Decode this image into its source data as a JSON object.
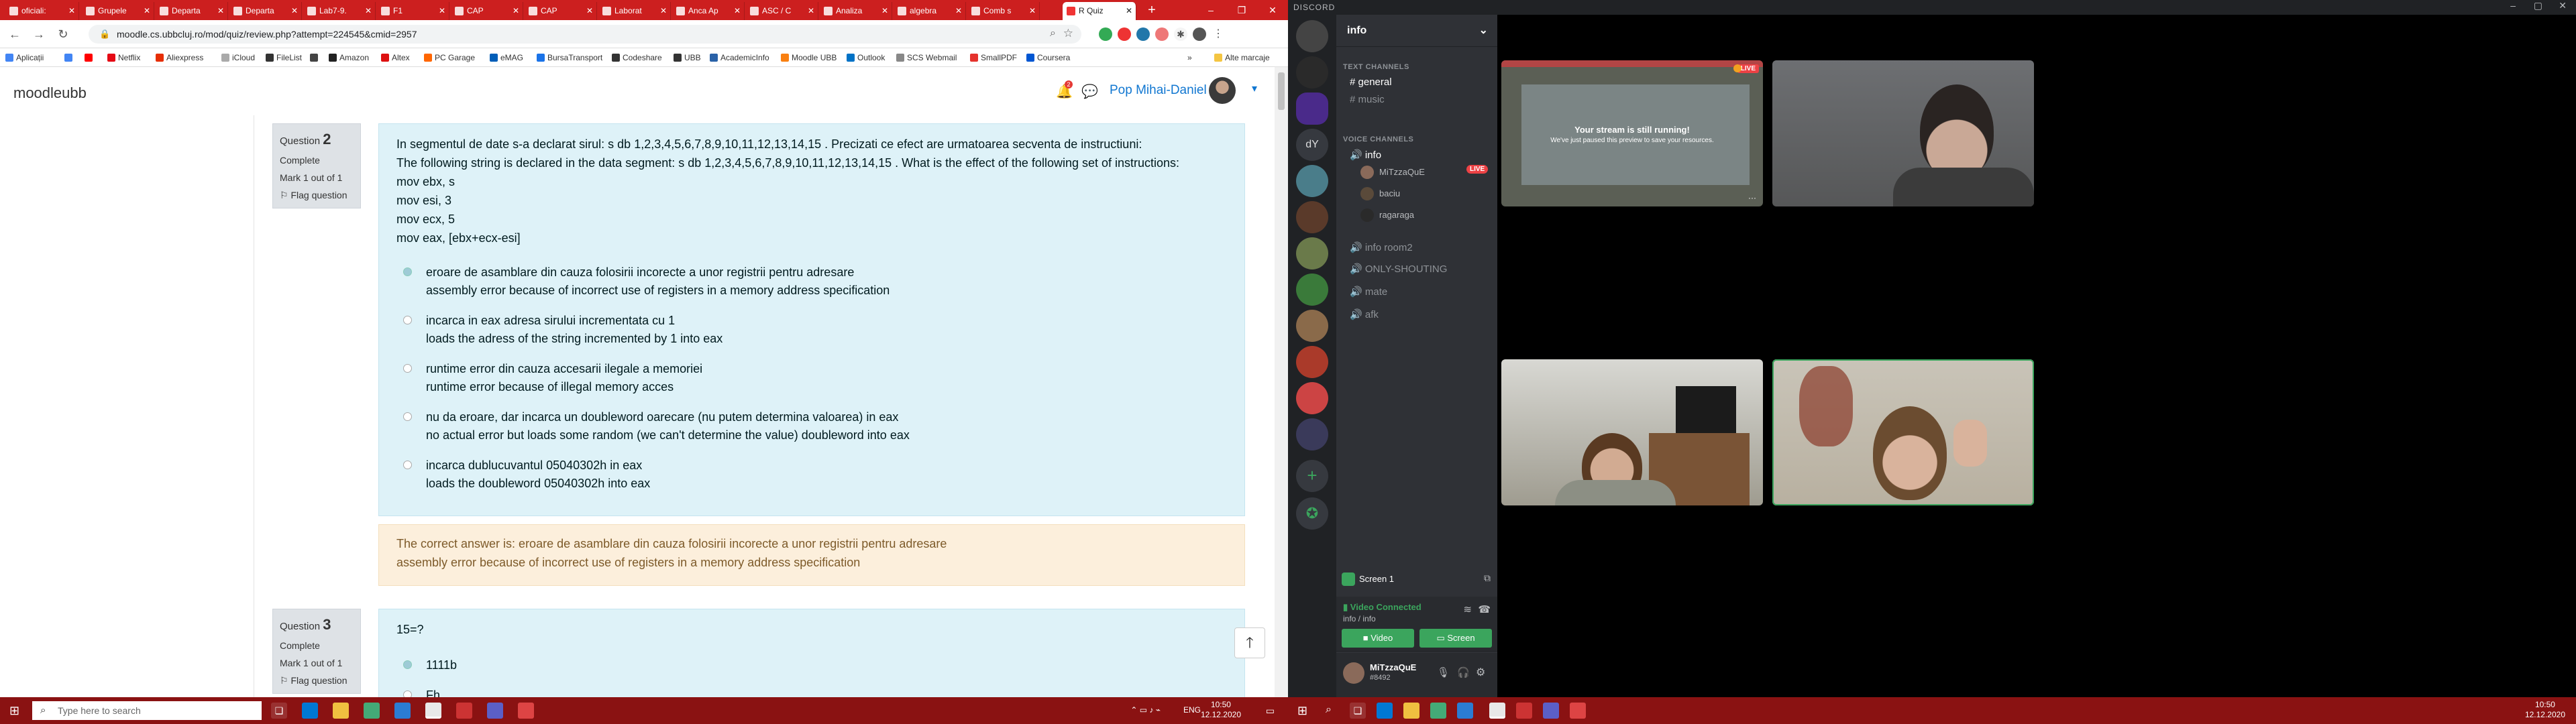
{
  "browser": {
    "tabs": [
      "oficiali:",
      "Grupele",
      "Departa",
      "Departa",
      "Lab7-9.",
      "F1",
      "CAP",
      "CAP",
      "Laborat",
      "Anca Ap",
      "ASC / C",
      "Analiza",
      "algebra",
      "Comb s",
      "R Quiz"
    ],
    "url": "moodle.cs.ubbcluj.ro/mod/quiz/review.php?attempt=224545&cmid=2957",
    "bookmarks": [
      "Aplicații",
      "",
      "",
      "Netflix",
      "Aliexpress",
      "iCloud",
      "FileList",
      "",
      "Amazon",
      "Altex",
      "PC Garage",
      "eMAG",
      "BursaTransport",
      "Codeshare",
      "UBB",
      "AcademicInfo",
      "Moodle UBB",
      "Outlook",
      "SCS Webmail",
      "SmallPDF",
      "Coursera",
      "»",
      "Alte marcaje"
    ]
  },
  "moodle": {
    "brand": "moodleubb",
    "user_name": "Pop Mihai-Daniel",
    "notification_count": "2",
    "question2": {
      "label": "Question",
      "number": "2",
      "state": "Complete",
      "mark": "Mark 1 out of 1",
      "flag": "Flag question",
      "text_ro": "In segmentul de date s-a declarat sirul: s db 1,2,3,4,5,6,7,8,9,10,11,12,13,14,15 . Precizati ce efect are urmatoarea secventa de instructiuni:",
      "text_en": "The following string is declared in the data segment: s db 1,2,3,4,5,6,7,8,9,10,11,12,13,14,15 . What is the effect of the following set of instructions:",
      "code": [
        "mov ebx, s",
        "mov esi, 3",
        "mov ecx, 5",
        "mov eax, [ebx+ecx-esi]"
      ],
      "answers": [
        {
          "ro": "eroare de asamblare din cauza folosirii incorecte a unor registrii pentru adresare",
          "en": "assembly error because of incorrect use of registers in a memory address specification"
        },
        {
          "ro": "incarca in eax adresa sirului incrementata cu 1",
          "en": "loads the adress of the string incremented by 1 into eax"
        },
        {
          "ro": "runtime error din cauza accesarii ilegale a memoriei",
          "en": "runtime error because of illegal memory acces"
        },
        {
          "ro": "nu da eroare, dar incarca un doubleword oarecare (nu putem determina valoarea) in eax",
          "en": "no actual error but loads some random (we can't determine the value) doubleword into eax"
        },
        {
          "ro": "incarca dublucuvantul 05040302h in eax",
          "en": "loads the doubleword 05040302h into eax"
        }
      ],
      "feedback_ro": "The correct answer is: eroare de asamblare din cauza folosirii incorecte a unor registrii pentru adresare",
      "feedback_en": "assembly error because of incorrect use of registers in a memory address specification"
    },
    "question3": {
      "label": "Question",
      "number": "3",
      "state": "Complete",
      "mark": "Mark 1 out of 1",
      "flag": "Flag question",
      "text": "15=?",
      "answers": [
        "1111b",
        "Fh"
      ]
    }
  },
  "taskbar_left": {
    "search_placeholder": "Type here to search",
    "lang": "ENG",
    "time": "10:50",
    "date": "12.12.2020"
  },
  "taskbar_right": {
    "time": "10:50",
    "date": "12.12.2020"
  },
  "discord": {
    "app_title": "DISCORD",
    "server_name": "info",
    "guild_label_dy": "dY",
    "text_category": "TEXT CHANNELS",
    "text_channels": [
      "general",
      "music"
    ],
    "voice_category": "VOICE CHANNELS",
    "voice_channel_active": "info",
    "voice_users": [
      "MiTzzaQuE",
      "baciu",
      "ragaraga"
    ],
    "live_badge": "LIVE",
    "voice_channels_other": [
      "info room2",
      "ONLY-SHOUTING",
      "mate",
      "afk"
    ],
    "screen_label": "Screen 1",
    "rtc_status": "Video Connected",
    "rtc_channel": "info / info",
    "video_button": "Video",
    "screen_button": "Screen",
    "self_name": "MiTzzaQuE",
    "self_tag": "#8492",
    "stream_title": "Your stream is still running!",
    "stream_sub": "We've just paused this preview to save your resources.",
    "live_tile_badge": "LIVE"
  }
}
